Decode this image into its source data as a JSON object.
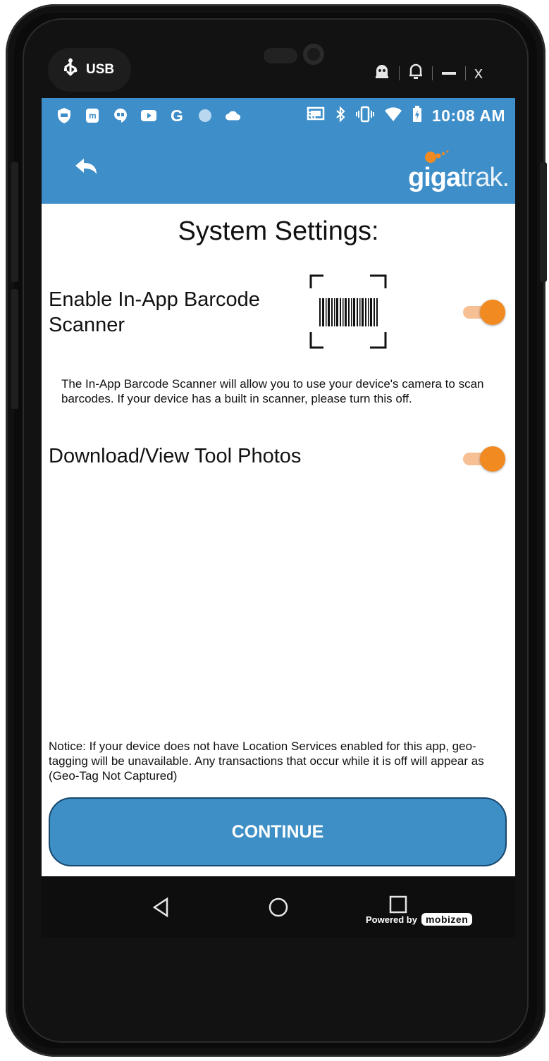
{
  "device": {
    "usb_label": "USB",
    "window_controls": [
      "ghost-icon",
      "bell-icon",
      "minimize-icon",
      "close-icon"
    ],
    "close_label": "x"
  },
  "status_bar": {
    "left_icons": [
      "shield-icon",
      "messenger-icon",
      "hangouts-icon",
      "youtube-icon",
      "google-icon",
      "dot-icon",
      "cloud-icon"
    ],
    "right_icons": [
      "cast-icon",
      "bluetooth-icon",
      "vibrate-icon",
      "wifi-icon",
      "battery-charging-icon"
    ],
    "time": "10:08 AM"
  },
  "app_bar": {
    "back_icon": "back-arrow-icon",
    "logo_text_bold": "giga",
    "logo_text_thin": "trak."
  },
  "page": {
    "title": "System Settings:",
    "settings": [
      {
        "label_line1": "Enable In-App Barcode",
        "label_line2": "Scanner",
        "enabled": true,
        "description": "The In-App Barcode Scanner will allow you to use your device's camera to scan barcodes. If your device has a built in scanner, please turn this off."
      },
      {
        "label": "Download/View Tool Photos",
        "enabled": true
      }
    ],
    "notice": "Notice: If your device does not have Location Services enabled for this app, geo-tagging will be unavailable. Any transactions that occur while it is off will appear as (Geo-Tag Not Captured)",
    "continue_label": "CONTINUE"
  },
  "nav_bar": {
    "buttons": [
      "back-triangle-icon",
      "home-circle-icon",
      "recents-square-icon"
    ],
    "powered_by": "Powered by",
    "brand": "mobizen"
  },
  "colors": {
    "primary": "#3d8ec9",
    "toggle_on": "#f28a22",
    "toggle_track": "#f6bf94",
    "button_border": "#17476d"
  }
}
